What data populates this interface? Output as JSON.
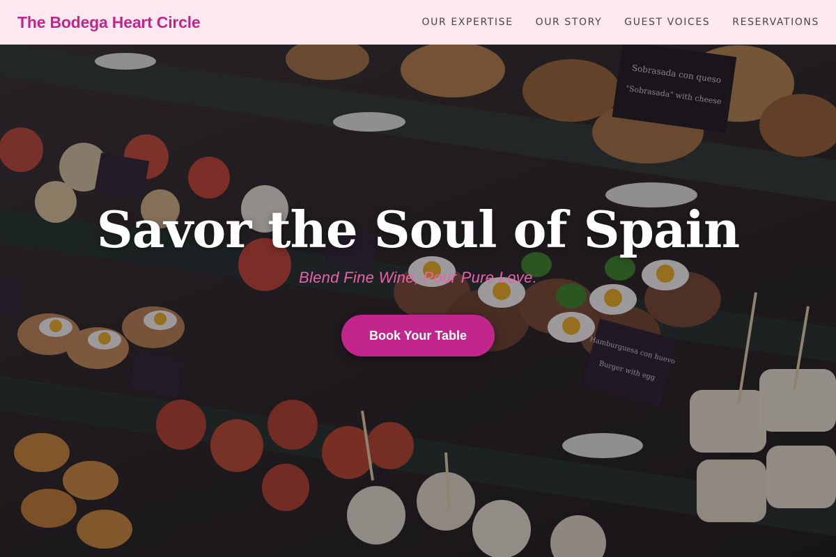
{
  "header": {
    "brand": "The Bodega Heart Circle",
    "nav": [
      {
        "label": "OUR EXPERTISE"
      },
      {
        "label": "OUR STORY"
      },
      {
        "label": "GUEST VOICES"
      },
      {
        "label": "RESERVATIONS"
      }
    ]
  },
  "hero": {
    "title": "Savor the Soul of Spain",
    "subtitle": "Blend Fine Wine, Pour Pure Love.",
    "cta_label": "Book Your Table",
    "background_image": "tapas-display-case-image",
    "signs": [
      "Sobrasada con queso",
      "\"Sobrasada\" with cheese",
      "Hamburguesa con huevo",
      "Burger with egg"
    ]
  },
  "colors": {
    "header_bg": "#fbe9ef",
    "brand": "#c2268c",
    "nav_text": "#4a4348",
    "accent_pink": "#ef5fae",
    "button_bg": "#c2268c"
  }
}
